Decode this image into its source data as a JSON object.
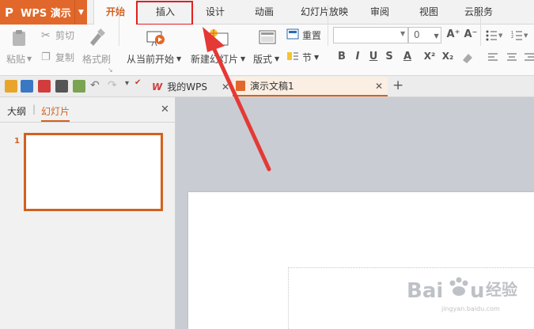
{
  "app": {
    "name": "WPS 演示",
    "logo": "P"
  },
  "menu_tabs": [
    "开始",
    "插入",
    "设计",
    "动画",
    "幻灯片放映",
    "审阅",
    "视图",
    "云服务"
  ],
  "ribbon": {
    "paste": "粘贴",
    "cut": "剪切",
    "copy": "复制",
    "format_painter": "格式刷",
    "from_current": "从当前开始",
    "new_slide": "新建幻灯片",
    "layout": "版式",
    "reset": "重置",
    "section": "节",
    "font_size": "0",
    "format_bold": "B",
    "format_italic": "I",
    "format_underline": "U",
    "format_strike": "S",
    "format_color": "A",
    "format_super": "X²",
    "format_sub": "X₂",
    "grow": "A⁺",
    "shrink": "A⁻"
  },
  "doc_tabs": [
    {
      "label": "我的WPS",
      "icon": "W"
    },
    {
      "label": "演示文稿1"
    }
  ],
  "panel": {
    "tab_outline": "大纲",
    "tab_slides": "幻灯片",
    "slide_number": "1"
  },
  "watermark": {
    "text": "Baidu 经验",
    "sub": "jingyan.baidu.com"
  },
  "colors": {
    "accent": "#d2611f",
    "app_button": "#e1682a",
    "highlight": "#e02020"
  }
}
